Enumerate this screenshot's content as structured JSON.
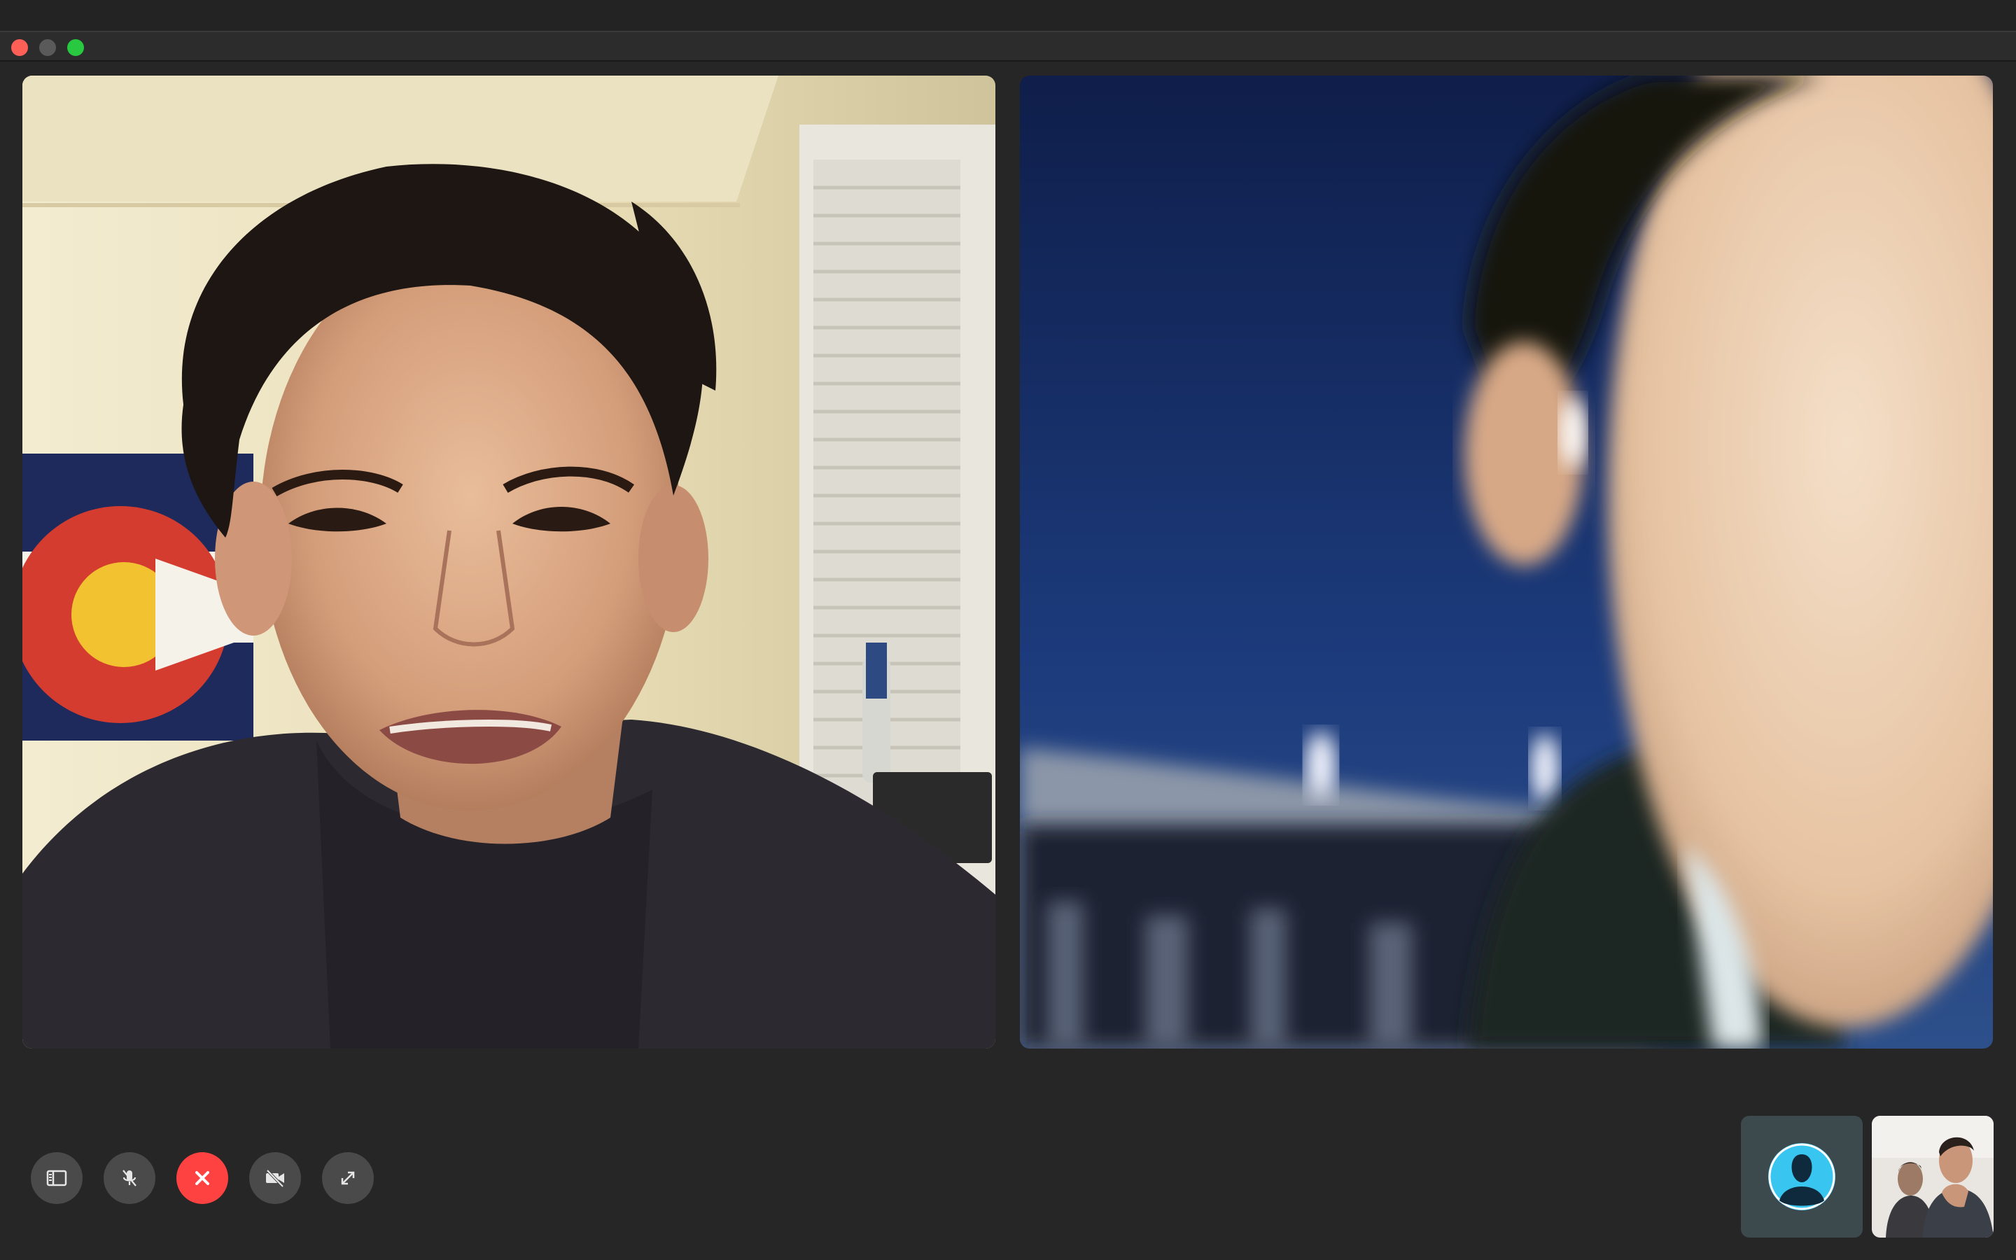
{
  "window": {
    "controls": [
      "close",
      "minimize",
      "maximize"
    ]
  },
  "participants": [
    {
      "role": "remote",
      "icon": "video-feed-person-indoors"
    },
    {
      "role": "remote",
      "icon": "video-feed-person-outdoors-night"
    }
  ],
  "toolbar": {
    "buttons": [
      {
        "icon": "sidebar-icon"
      },
      {
        "icon": "mic-muted-icon"
      },
      {
        "icon": "end-call-icon",
        "color": "#fe4141"
      },
      {
        "icon": "camera-off-icon"
      },
      {
        "icon": "fullscreen-icon"
      }
    ]
  },
  "thumbnails": [
    {
      "icon": "user-avatar-icon",
      "accent": "#38c5f0"
    },
    {
      "icon": "self-view-feed"
    }
  ]
}
